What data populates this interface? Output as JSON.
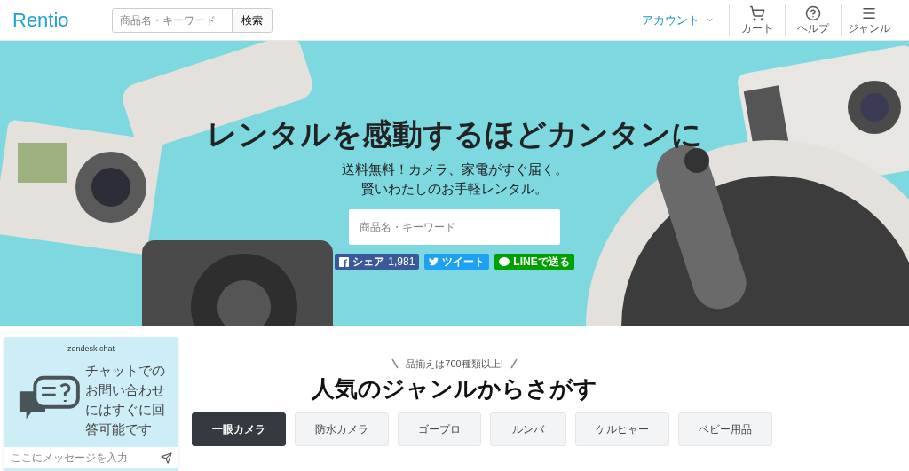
{
  "header": {
    "logo": "Rentio",
    "search": {
      "placeholder": "商品名・キーワード",
      "button": "検索"
    },
    "account": "アカウント",
    "nav": [
      {
        "kind": "cart",
        "label": "カート"
      },
      {
        "kind": "help",
        "label": "ヘルプ"
      },
      {
        "kind": "menu",
        "label": "ジャンル"
      }
    ]
  },
  "hero": {
    "kind": "picture",
    "title": "レンタルを感動するほどカンタンに",
    "subtitle": [
      "送料無料！カメラ、家電がすぐ届く。",
      "賢いわたしのお手軽レンタル。"
    ],
    "search": {
      "placeholder": "商品名・キーワード"
    },
    "share": [
      {
        "kind": "facebook",
        "label": "シェア",
        "count": "1,981"
      },
      {
        "kind": "twitter",
        "label": "ツイート"
      },
      {
        "kind": "line",
        "label": "LINEで送る"
      }
    ]
  },
  "genres": {
    "tagline": "品揃えは700種類以上!",
    "title": "人気のジャンルからさがす",
    "tabs": [
      {
        "label": "一眼カメラ",
        "selected": true
      },
      {
        "label": "防水カメラ",
        "selected": false
      },
      {
        "label": "ゴープロ",
        "selected": false
      },
      {
        "label": "ルンバ",
        "selected": false
      },
      {
        "label": "ケルヒャー",
        "selected": false
      },
      {
        "label": "ベビー用品",
        "selected": false
      }
    ]
  },
  "chat": {
    "brand": "zendesk chat",
    "message": "チャットでのお問い合わせにはすぐに回答可能です",
    "input": {
      "placeholder": "ここにメッセージを入力"
    }
  }
}
